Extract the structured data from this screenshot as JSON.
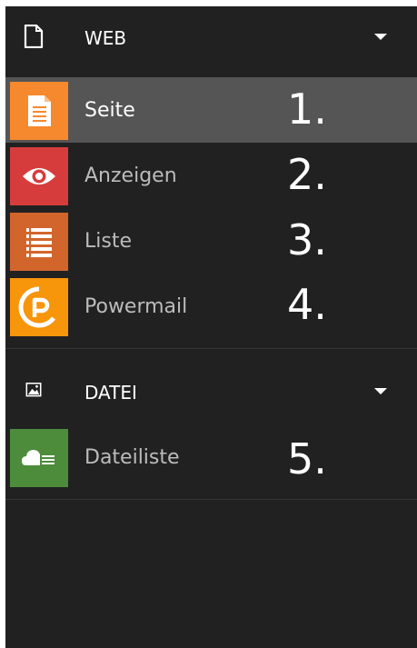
{
  "groups": [
    {
      "label": "WEB",
      "icon": "page-icon",
      "modules": [
        {
          "label": "Seite",
          "icon": "page-module-icon",
          "color": "#f6892d",
          "annotation": "1.",
          "active": true
        },
        {
          "label": "Anzeigen",
          "icon": "eye-icon",
          "color": "#d73c3c",
          "annotation": "2.",
          "active": false
        },
        {
          "label": "Liste",
          "icon": "list-icon",
          "color": "#d2652c",
          "annotation": "3.",
          "active": false
        },
        {
          "label": "Powermail",
          "icon": "powermail-icon",
          "color": "#f7950b",
          "annotation": "4.",
          "active": false
        }
      ]
    },
    {
      "label": "DATEI",
      "icon": "image-icon",
      "modules": [
        {
          "label": "Dateiliste",
          "icon": "cloud-file-icon",
          "color": "#4d8c3a",
          "annotation": "5.",
          "active": false
        }
      ]
    }
  ],
  "colors": {
    "panel_background": "#212121",
    "active_background": "#555555"
  }
}
